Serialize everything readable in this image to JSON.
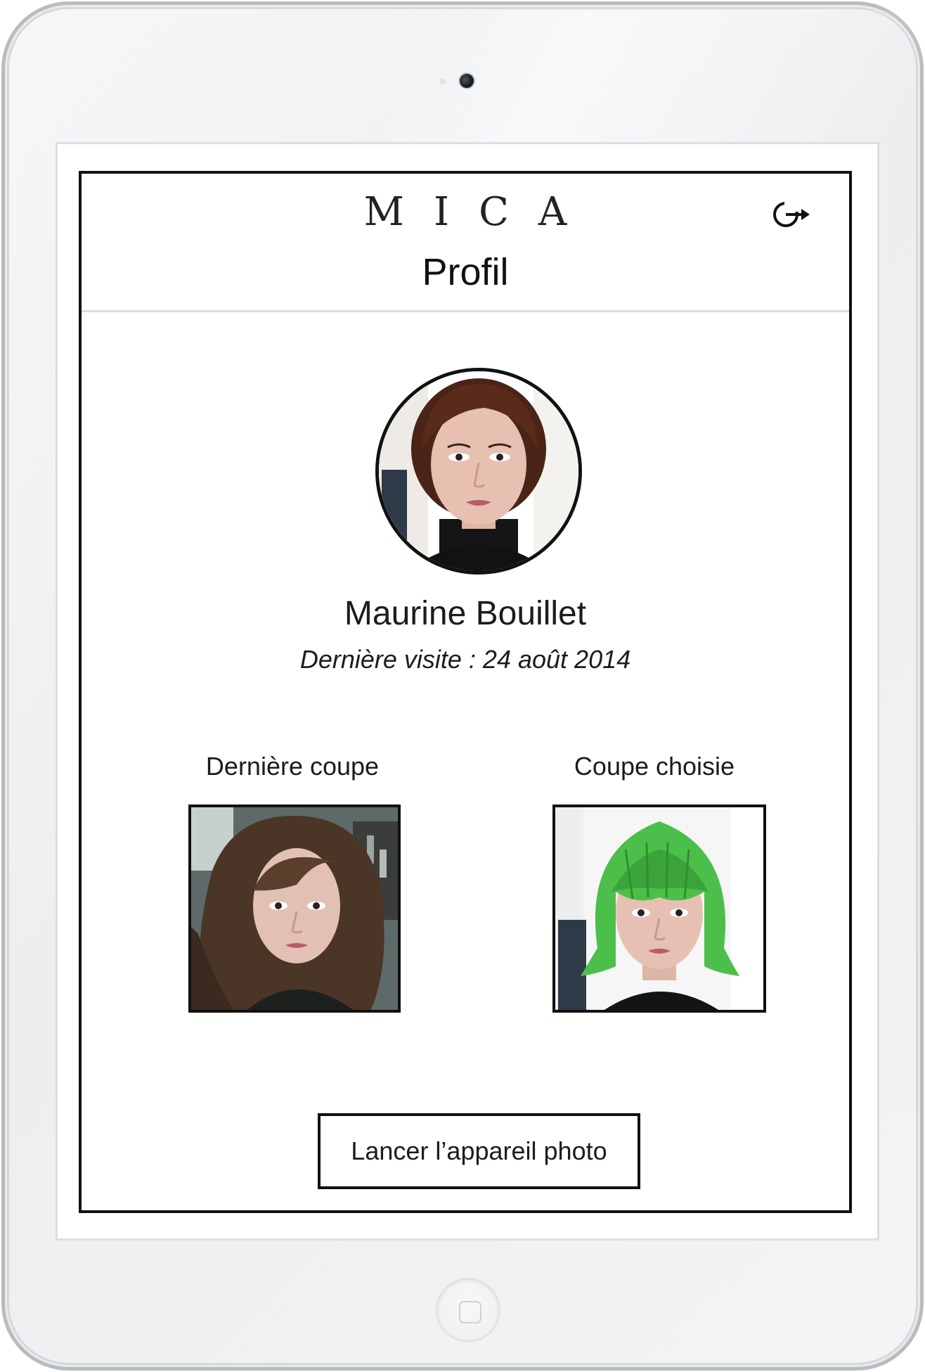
{
  "header": {
    "brand": "MICA",
    "title": "Profil",
    "logout_icon": "logout-icon"
  },
  "profile": {
    "name": "Maurine Bouillet",
    "last_visit": "Dernière visite : 24 août 2014",
    "avatar_icon": "profile-photo"
  },
  "haircuts": {
    "last": {
      "label": "Dernière coupe"
    },
    "chosen": {
      "label": "Coupe choisie"
    }
  },
  "actions": {
    "camera_button": "Lancer l’appareil photo"
  },
  "colors": {
    "frame": "#111111",
    "divider": "#d9dadb",
    "wig": "#4cbf4a"
  }
}
